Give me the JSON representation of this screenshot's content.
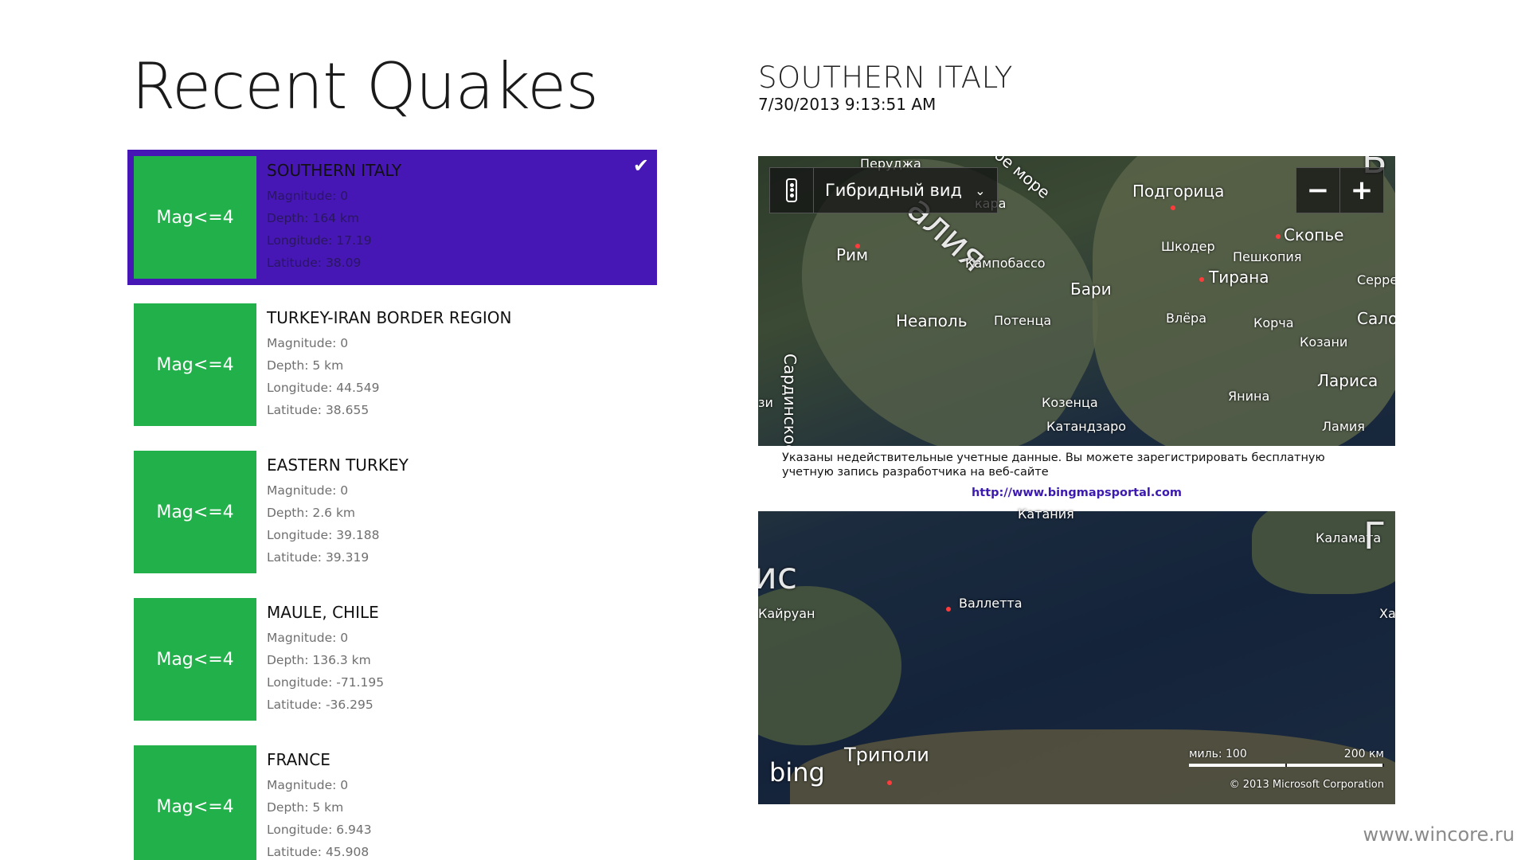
{
  "page": {
    "title": "Recent Quakes"
  },
  "quakes": [
    {
      "tile": "Mag<=4",
      "name": "SOUTHERN ITALY",
      "magnitude": "Magnitude: 0",
      "depth": "Depth: 164 km",
      "longitude": "Longitude: 17.19",
      "latitude": "Latitude: 38.09",
      "selected": true
    },
    {
      "tile": "Mag<=4",
      "name": "TURKEY-IRAN BORDER REGION",
      "magnitude": "Magnitude: 0",
      "depth": "Depth: 5 km",
      "longitude": "Longitude: 44.549",
      "latitude": "Latitude: 38.655"
    },
    {
      "tile": "Mag<=4",
      "name": "EASTERN TURKEY",
      "magnitude": "Magnitude: 0",
      "depth": "Depth: 2.6 km",
      "longitude": "Longitude: 39.188",
      "latitude": "Latitude: 39.319"
    },
    {
      "tile": "Mag<=4",
      "name": "MAULE, CHILE",
      "magnitude": "Magnitude: 0",
      "depth": "Depth: 136.3 km",
      "longitude": "Longitude: -71.195",
      "latitude": "Latitude: -36.295"
    },
    {
      "tile": "Mag<=4",
      "name": "FRANCE",
      "magnitude": "Magnitude: 0",
      "depth": "Depth: 5 km",
      "longitude": "Longitude: 6.943",
      "latitude": "Latitude: 45.908"
    }
  ],
  "detail": {
    "title": "SOUTHERN ITALY",
    "time": "7/30/2013 9:13:51 AM"
  },
  "map": {
    "view_mode": "Гибридный вид",
    "zoom_out": "−",
    "zoom_in": "+",
    "labels": {
      "italy": "алия",
      "rome": "Рим",
      "naples": "Неаполь",
      "campobasso": "Кампобассо",
      "bari": "Бари",
      "potenza": "Потенца",
      "cosenza": "Козенца",
      "catanzaro": "Катандзаро",
      "podgorica": "Подгорица",
      "skopje": "Скопье",
      "shkoder": "Шкодер",
      "peshkopi": "Пешкопия",
      "tirana": "Тирана",
      "vlore": "Влёра",
      "korca": "Корча",
      "kozani": "Козани",
      "larisa": "Лариса",
      "janina": "Янина",
      "lamia": "Ламия",
      "sardinia": "Сардинское",
      "perugia": "Перуджа",
      "sea": "ое море",
      "pescara": "кара",
      "serres": "Серре",
      "thessaloniki": "Сало",
      "kalamata": "Каламата",
      "valletta": "Валлетта",
      "kairouan": "Кайруан",
      "tunisia": "ис",
      "tripoli": "Триполи",
      "ha": "Ха",
      "catania": "Катания",
      "b": "Б",
      "r": "Г",
      "left_edge": "зи"
    },
    "credentials_text": "Указаны недействительные учетные данные. Вы можете зарегистрировать бесплатную учетную запись разработчика на веб-сайте",
    "credentials_link": "http://www.bingmapsportal.com",
    "logo": "bing",
    "scale_miles": "миль: 100",
    "scale_km": "200 км",
    "copyright": "© 2013 Microsoft Corporation"
  },
  "watermark": "www.wincore.ru",
  "colors": {
    "accent": "#4617b4",
    "tile": "#22b04b"
  }
}
